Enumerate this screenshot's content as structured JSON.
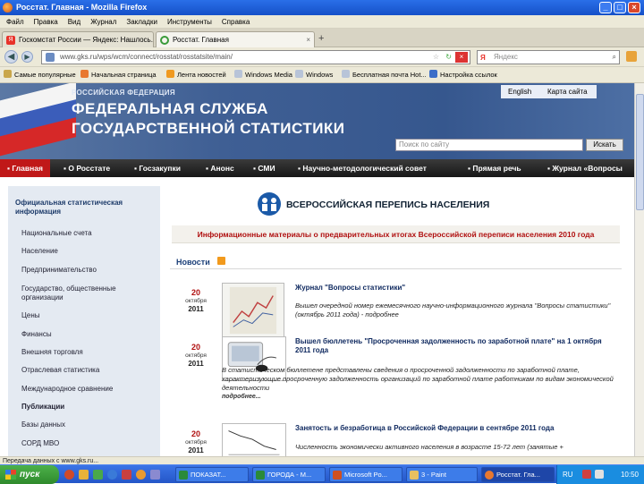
{
  "window": {
    "title": "Росстат. Главная - Mozilla Firefox"
  },
  "menu": [
    "Файл",
    "Правка",
    "Вид",
    "Журнал",
    "Закладки",
    "Инструменты",
    "Справка"
  ],
  "tabs": [
    {
      "label": "Госкомстат России — Яндекс: Нашлось..."
    },
    {
      "label": "Росстат. Главная"
    }
  ],
  "nav": {
    "url": "www.gks.ru/wps/wcm/connect/rosstat/rosstatsite/main/",
    "search_placeholder": "Яндекс"
  },
  "bookmarks": [
    "Самые популярные",
    "Начальная страница",
    "Лента новостей",
    "Windows Media",
    "Windows",
    "Бесплатная почта Hot...",
    "Настройка ссылок"
  ],
  "header": {
    "subtitle": "РОССИЙСКАЯ ФЕДЕРАЦИЯ",
    "title_line1": "ФЕДЕРАЛЬНАЯ СЛУЖБА",
    "title_line2": "ГОСУДАРСТВЕННОЙ СТАТИСТИКИ",
    "lang_en": "English",
    "sitemap": "Карта сайта",
    "search_placeholder": "Поиск по сайту",
    "search_button": "Искать"
  },
  "main_nav": [
    "Главная",
    "О Росстате",
    "Госзакупки",
    "Анонс",
    "СМИ",
    "Научно-методологический совет",
    "Прямая речь",
    "Журнал «Вопросы"
  ],
  "sidebar": {
    "heading": "Официальная статистическая информация",
    "items": [
      "Национальные счета",
      "Население",
      "Предпринимательство",
      "Государство, общественные организации",
      "Цены",
      "Финансы",
      "Внешняя торговля",
      "Отраслевая статистика",
      "Международное сравнение",
      "Публикации",
      "Базы данных",
      "СОРД МВО"
    ]
  },
  "census": {
    "title": "ВСЕРОССИЙСКАЯ ПЕРЕПИСЬ НАСЕЛЕНИЯ",
    "info": "Информационные материалы о предварительных итогах Всероссийской переписи населения 2010 года"
  },
  "news": {
    "title": "Новости",
    "items": [
      {
        "day": "20",
        "month": "октября",
        "year": "2011",
        "title": "Журнал \"Вопросы статистики\"",
        "text": "Вышел очередной номер ежемесячного научно-информационного журнала \"Вопросы статистики\" (октябрь 2011 года) - подробнее",
        "more": ""
      },
      {
        "day": "20",
        "month": "октября",
        "year": "2011",
        "title": "Вышел бюллетень \"Просроченная задолженность по заработной плате\" на 1 октября 2011 года",
        "text": "В статистическом бюллетене представлены сведения о просроченной задолженности по заработной плате, характеризующие просроченную задолженность организаций по заработной плате работникам по видам экономической деятельности",
        "more": "подробнее..."
      },
      {
        "day": "20",
        "month": "октября",
        "year": "2011",
        "title": "Занятость и безработица в Российской Федерации в сентябре 2011 года",
        "text": "Численность экономически активного населения в возрасте 15-72 лет (занятые +",
        "more": ""
      }
    ]
  },
  "status": "Передача данных с www.gks.ru...",
  "taskbar": {
    "start": "пуск",
    "items": [
      "ПОКАЗАТ...",
      "ГОРОДА - М...",
      "Microsoft Po...",
      "3 - Paint",
      "Росстат. Гла..."
    ],
    "lang": "RU",
    "time": "10:50"
  }
}
